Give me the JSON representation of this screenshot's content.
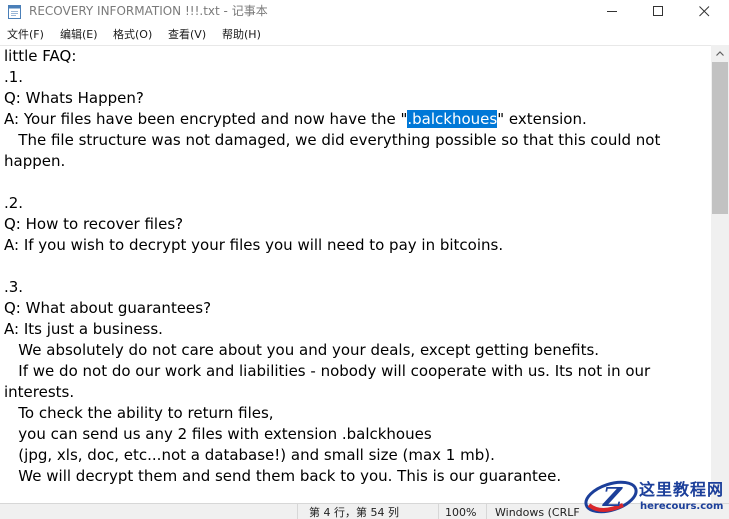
{
  "window": {
    "title": "RECOVERY INFORMATION !!!.txt - 记事本"
  },
  "icons": {
    "app": "notepad-icon",
    "minimize": "minimize-icon",
    "maximize": "maximize-icon",
    "close": "close-icon",
    "scroll_up": "chevron-up-icon"
  },
  "menu": {
    "items": [
      "文件(F)",
      "编辑(E)",
      "格式(O)",
      "查看(V)",
      "帮助(H)"
    ]
  },
  "document": {
    "lines": [
      "little FAQ:",
      ".1.",
      "Q: Whats Happen?",
      "",
      "   The file structure was not damaged, we did everything possible so that this could not",
      "happen.",
      "",
      ".2.",
      "Q: How to recover files?",
      "A: If you wish to decrypt your files you will need to pay in bitcoins.",
      "",
      ".3.",
      "Q: What about guarantees?",
      "A: Its just a business.",
      "   We absolutely do not care about you and your deals, except getting benefits.",
      "   If we do not do our work and liabilities - nobody will cooperate with us. Its not in our",
      "interests.",
      "   To check the ability to return files,",
      "   you can send us any 2 files with extension .balckhoues",
      "   (jpg, xls, doc, etc...not a database!) and small size (max 1 mb).",
      "   We will decrypt them and send them back to you. This is our guarantee."
    ],
    "line4": {
      "before": "A: Your files have been encrypted and now have the \"",
      "selected": ".balckhoues",
      "after": "\" extension."
    }
  },
  "status": {
    "position": "第 4 行，第 54 列",
    "zoom": "100%",
    "line_ending": "Windows (CRLF"
  },
  "watermark": {
    "title": "这里教程网",
    "url": "herecours.com"
  },
  "colors": {
    "selection": "#0078d7",
    "watermark_blue": "#1c3f9a",
    "watermark_red": "#d9262b"
  }
}
